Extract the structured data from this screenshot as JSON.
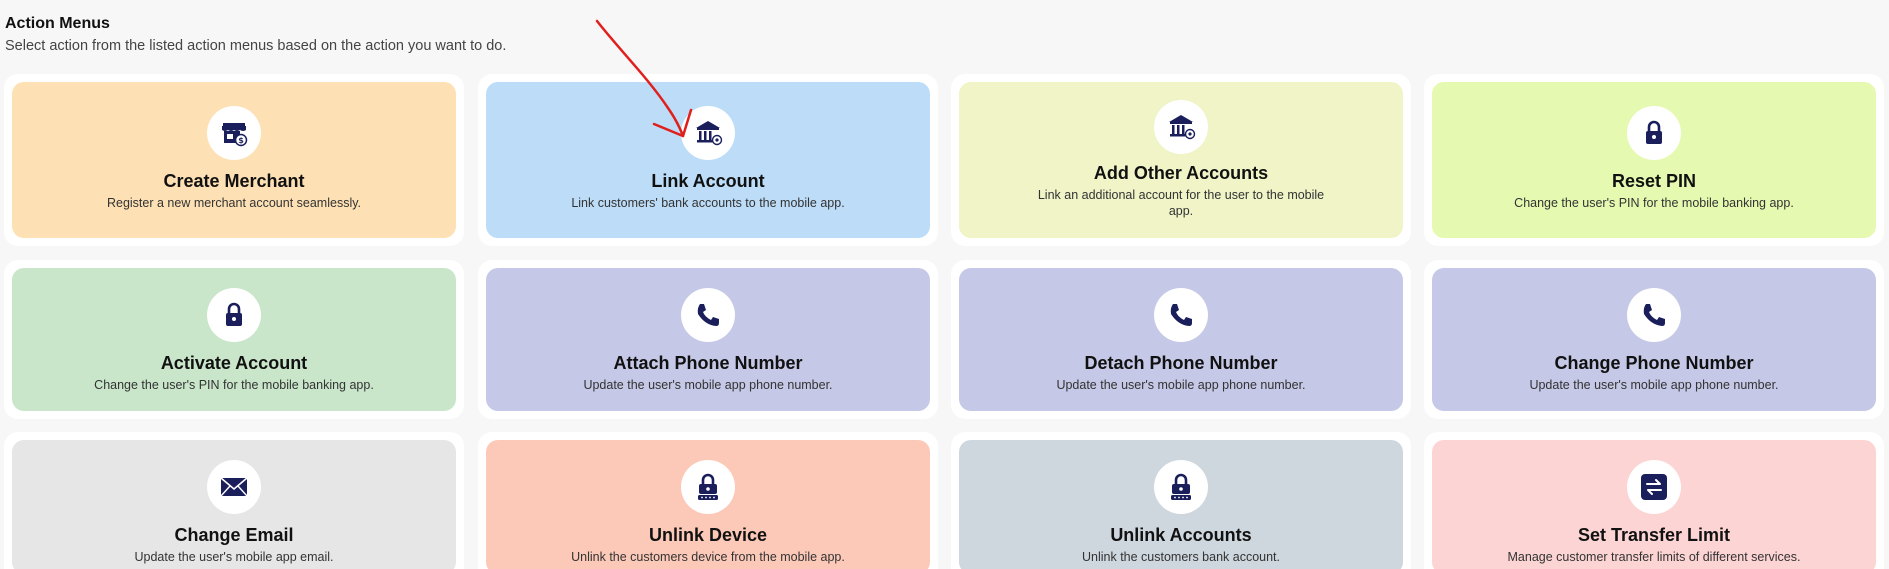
{
  "header": {
    "title": "Action Menus",
    "subtitle": "Select action from the listed action menus based on the action you want to do."
  },
  "colors": {
    "icon": "#1a1f5c",
    "annotation": "#e0201c",
    "create_merchant": "#fde0b4",
    "link_account": "#bcdcf7",
    "add_other_accounts": "#f0f4c7",
    "reset_pin": "#e5f9b1",
    "activate_account": "#c9e6ca",
    "attach_phone": "#c5c8e6",
    "detach_phone": "#c5c8e6",
    "change_phone": "#c5c8e6",
    "change_email": "#e6e6e6",
    "unlink_device": "#fcc9b8",
    "unlink_accounts": "#cfd7de",
    "set_transfer_limit": "#fdd4d4"
  },
  "cards": [
    {
      "title": "Create Merchant",
      "desc": "Register a new merchant account seamlessly.",
      "icon": "store-icon"
    },
    {
      "title": "Link Account",
      "desc": "Link customers' bank accounts to the mobile app.",
      "icon": "bank-icon"
    },
    {
      "title": "Add Other Accounts",
      "desc": "Link an additional account for the user to the mobile app.",
      "icon": "bank-icon"
    },
    {
      "title": "Reset PIN",
      "desc": "Change the user's PIN for the mobile banking app.",
      "icon": "lock-icon"
    },
    {
      "title": "Activate Account",
      "desc": "Change the user's PIN for the mobile banking app.",
      "icon": "lock-icon"
    },
    {
      "title": "Attach Phone Number",
      "desc": "Update the user's mobile app phone number.",
      "icon": "phone-icon"
    },
    {
      "title": "Detach Phone Number",
      "desc": "Update the user's mobile app phone number.",
      "icon": "phone-icon"
    },
    {
      "title": "Change Phone Number",
      "desc": "Update the user's mobile app phone number.",
      "icon": "phone-icon"
    },
    {
      "title": "Change Email",
      "desc": "Update the user's mobile app email.",
      "icon": "envelope-icon"
    },
    {
      "title": "Unlink Device",
      "desc": "Unlink the customers device from the mobile app.",
      "icon": "lock-password-icon"
    },
    {
      "title": "Unlink Accounts",
      "desc": "Unlink the customers bank account.",
      "icon": "lock-password-icon"
    },
    {
      "title": "Set Transfer Limit",
      "desc": "Manage customer transfer limits of different services.",
      "icon": "transfer-icon"
    }
  ]
}
